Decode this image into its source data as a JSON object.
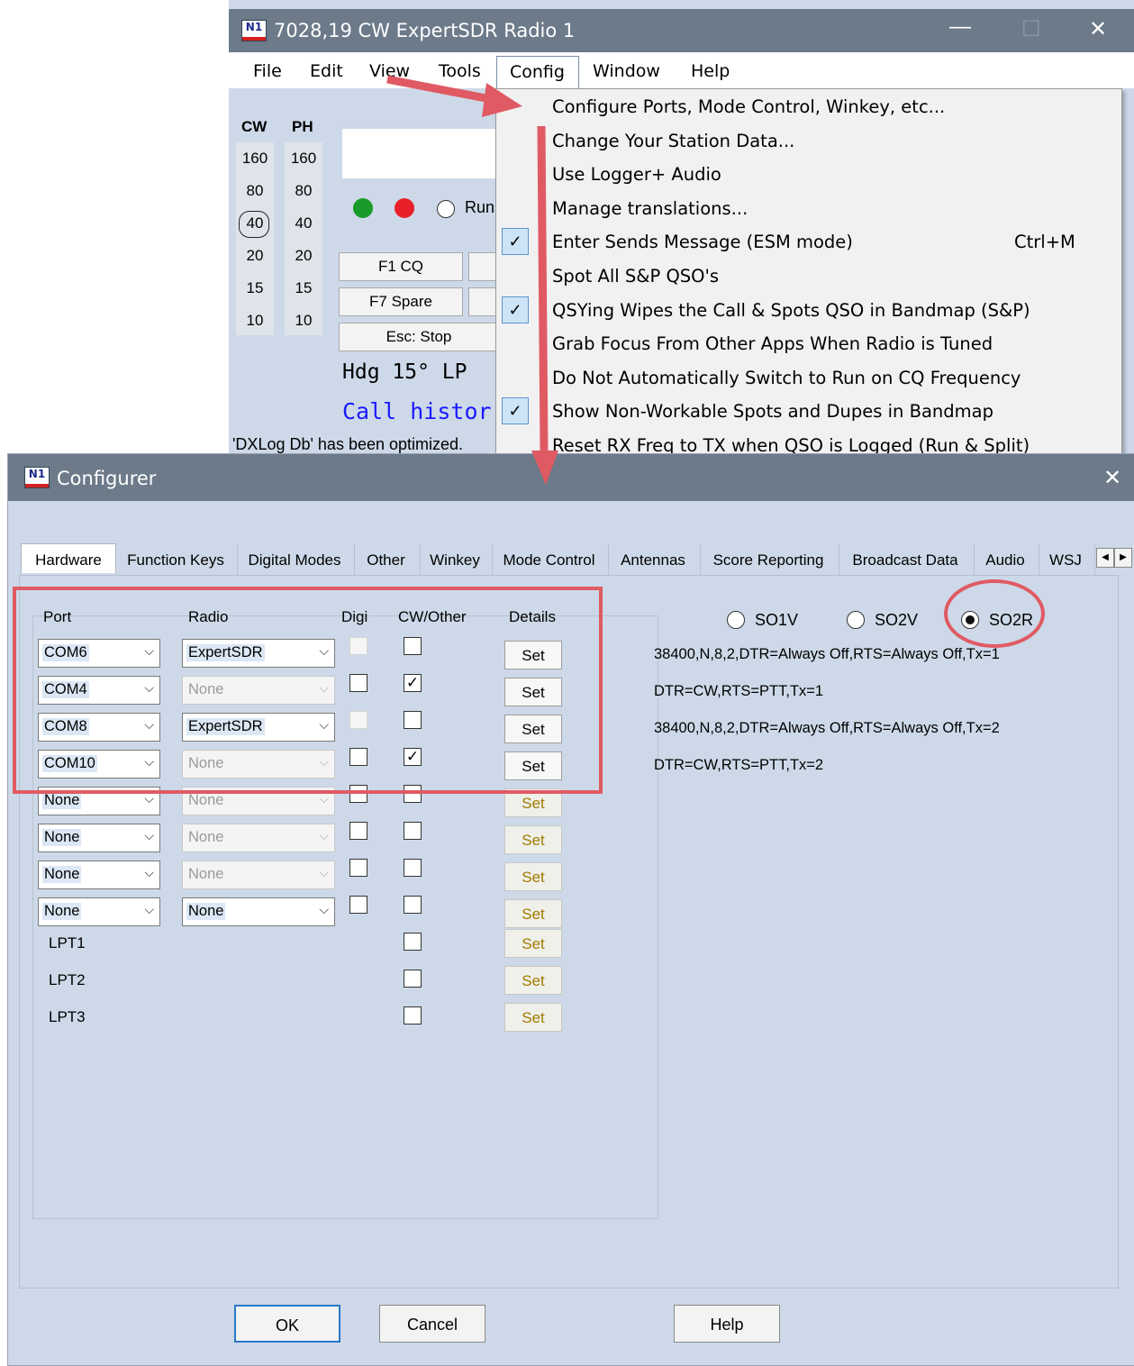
{
  "main_window": {
    "title": "7028,19 CW ExpertSDR Radio 1",
    "logo": "N1",
    "controls": {
      "minimize": "—",
      "maximize": "☐",
      "close": "✕"
    },
    "menus": [
      "File",
      "Edit",
      "View",
      "Tools",
      "Config",
      "Window",
      "Help"
    ],
    "band_headers": [
      "CW",
      "PH"
    ],
    "bands_cw": [
      "160",
      "80",
      "40",
      "20",
      "15",
      "10"
    ],
    "bands_ph": [
      "160",
      "80",
      "40",
      "20",
      "15",
      "10"
    ],
    "selected_band": "40",
    "run_label": "Run",
    "fkeys": [
      "F1 CQ",
      "F7 Spare",
      "Esc: Stop"
    ],
    "heading": "Hdg 15° LP",
    "call_history": "Call histor",
    "status": "'DXLog Db' has been optimized."
  },
  "config_menu": {
    "items": [
      {
        "label": "Configure Ports, Mode Control, Winkey, etc...",
        "checked": false,
        "shortcut": ""
      },
      {
        "label": "Change Your Station Data...",
        "checked": false,
        "shortcut": ""
      },
      {
        "label": "Use Logger+ Audio",
        "checked": false,
        "shortcut": ""
      },
      {
        "label": "Manage translations...",
        "checked": false,
        "shortcut": ""
      },
      {
        "label": "Enter Sends Message (ESM mode)",
        "checked": true,
        "shortcut": "Ctrl+M"
      },
      {
        "label": "Spot All S&P QSO's",
        "checked": false,
        "shortcut": ""
      },
      {
        "label": "QSYing Wipes the Call & Spots QSO in Bandmap (S&P)",
        "checked": true,
        "shortcut": ""
      },
      {
        "label": "Grab Focus From Other Apps When Radio is Tuned",
        "checked": false,
        "shortcut": ""
      },
      {
        "label": "Do Not Automatically Switch to Run on CQ Frequency",
        "checked": false,
        "shortcut": ""
      },
      {
        "label": "Show Non-Workable Spots and Dupes in Bandmap",
        "checked": true,
        "shortcut": ""
      },
      {
        "label": "Reset RX Freq to TX when QSO is Logged (Run & Split)",
        "checked": false,
        "shortcut": ""
      }
    ]
  },
  "configurer": {
    "title": "Configurer",
    "logo": "N1",
    "close": "✕",
    "tabs": [
      "Hardware",
      "Function Keys",
      "Digital Modes",
      "Other",
      "Winkey",
      "Mode Control",
      "Antennas",
      "Score Reporting",
      "Broadcast Data",
      "Audio",
      "WSJ"
    ],
    "active_tab": "Hardware",
    "scroll_left": "◀",
    "scroll_right": "▶",
    "columns": {
      "port": "Port",
      "radio": "Radio",
      "digi": "Digi",
      "cw_other": "CW/Other",
      "details": "Details"
    },
    "rows": [
      {
        "port": "COM6",
        "radio": "ExpertSDR",
        "radio_enabled": true,
        "digi": false,
        "digi_enabled": false,
        "cw": false,
        "set": "Set",
        "set_enabled": true,
        "detail": "38400,N,8,2,DTR=Always Off,RTS=Always Off,Tx=1"
      },
      {
        "port": "COM4",
        "radio": "None",
        "radio_enabled": false,
        "digi": false,
        "digi_enabled": true,
        "cw": true,
        "set": "Set",
        "set_enabled": true,
        "detail": "DTR=CW,RTS=PTT,Tx=1"
      },
      {
        "port": "COM8",
        "radio": "ExpertSDR",
        "radio_enabled": true,
        "digi": false,
        "digi_enabled": false,
        "cw": false,
        "set": "Set",
        "set_enabled": true,
        "detail": "38400,N,8,2,DTR=Always Off,RTS=Always Off,Tx=2"
      },
      {
        "port": "COM10",
        "radio": "None",
        "radio_enabled": false,
        "digi": false,
        "digi_enabled": true,
        "cw": true,
        "set": "Set",
        "set_enabled": true,
        "detail": "DTR=CW,RTS=PTT,Tx=2"
      },
      {
        "port": "None",
        "radio": "None",
        "radio_enabled": false,
        "digi": false,
        "digi_enabled": true,
        "cw": false,
        "set": "Set",
        "set_enabled": false,
        "detail": ""
      },
      {
        "port": "None",
        "radio": "None",
        "radio_enabled": false,
        "digi": false,
        "digi_enabled": true,
        "cw": false,
        "set": "Set",
        "set_enabled": false,
        "detail": ""
      },
      {
        "port": "None",
        "radio": "None",
        "radio_enabled": false,
        "digi": false,
        "digi_enabled": true,
        "cw": false,
        "set": "Set",
        "set_enabled": false,
        "detail": ""
      },
      {
        "port": "None",
        "radio": "None",
        "radio_enabled": true,
        "digi": false,
        "digi_enabled": true,
        "cw": false,
        "set": "Set",
        "set_enabled": false,
        "detail": ""
      }
    ],
    "lpt_rows": [
      {
        "port": "LPT1",
        "cw": false,
        "set": "Set"
      },
      {
        "port": "LPT2",
        "cw": false,
        "set": "Set"
      },
      {
        "port": "LPT3",
        "cw": false,
        "set": "Set"
      }
    ],
    "station_modes": [
      {
        "label": "SO1V",
        "selected": false
      },
      {
        "label": "SO2V",
        "selected": false
      },
      {
        "label": "SO2R",
        "selected": true
      }
    ],
    "buttons": {
      "ok": "OK",
      "cancel": "Cancel",
      "help": "Help"
    }
  },
  "colors": {
    "title_bar": "#6c7a89",
    "window_bg": "#cdd9e8",
    "annotation": "#e05a63",
    "led_green": "#1a9a2a",
    "led_red": "#e8202a",
    "call_history_text": "#1a1aff"
  }
}
